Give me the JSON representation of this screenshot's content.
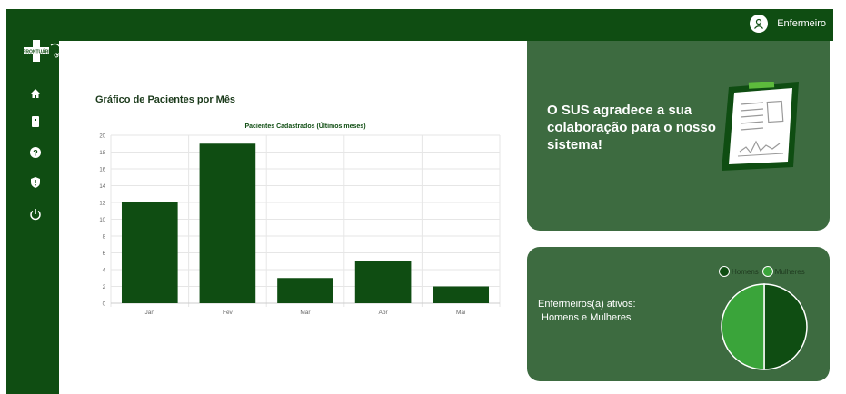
{
  "header": {
    "logo_text": "PRONTUÁRIO",
    "user_label": "Enfermeiro"
  },
  "sidebar": {
    "items": [
      {
        "name": "home-icon"
      },
      {
        "name": "clipboard-icon"
      },
      {
        "name": "help-icon"
      },
      {
        "name": "shield-icon"
      },
      {
        "name": "power-icon"
      }
    ]
  },
  "main": {
    "chart_section_title": "Gráfico de Pacientes por Mês"
  },
  "card_thanks": {
    "text": "O SUS agradece a sua colaboração para o nosso sistema!"
  },
  "card_nurses": {
    "line1": "Enfermeiros(a) ativos:",
    "line2": "Homens e Mulheres",
    "legend": [
      "Homens",
      "Mulheres"
    ]
  },
  "colors": {
    "primary": "#0f4d12",
    "card": "#3d6b40",
    "women": "#3aa43a",
    "men": "#0f4d12"
  },
  "chart_data": [
    {
      "type": "bar",
      "title": "Pacientes Cadastrados (Últimos meses)",
      "categories": [
        "Jan",
        "Fev",
        "Mar",
        "Abr",
        "Mai"
      ],
      "values": [
        12,
        19,
        3,
        5,
        2
      ],
      "ylim": [
        0,
        20
      ],
      "yticks": [
        0,
        2,
        4,
        6,
        8,
        10,
        12,
        14,
        16,
        18,
        20
      ],
      "grid": true,
      "xlabel": "",
      "ylabel": ""
    },
    {
      "type": "pie",
      "categories": [
        "Homens",
        "Mulheres"
      ],
      "values": [
        50,
        50
      ],
      "legend": "top-right"
    }
  ]
}
